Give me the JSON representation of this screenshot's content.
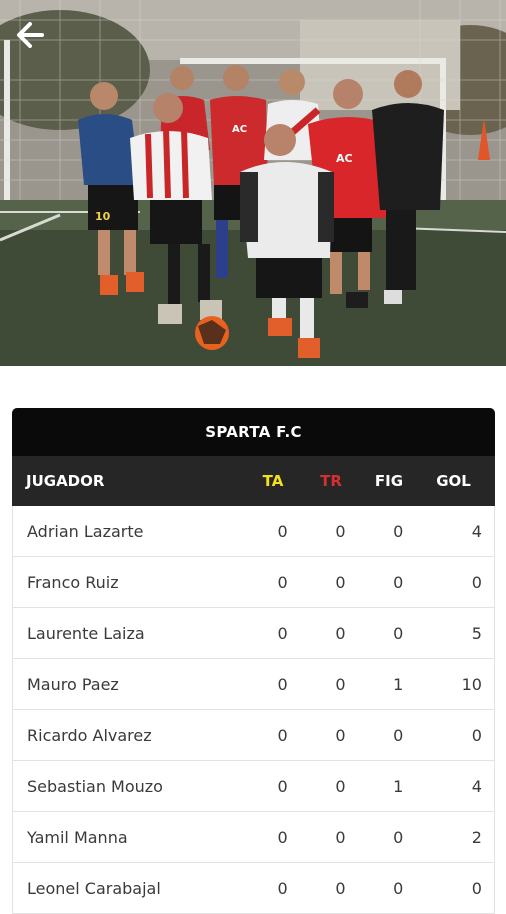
{
  "header": {
    "back_icon": "arrow-left-icon"
  },
  "photo": {
    "subject": "team-photo",
    "shirt_labels": [
      "10",
      "AC",
      "AC"
    ]
  },
  "table": {
    "team_name": "SPARTA F.C",
    "columns": {
      "player": "JUGADOR",
      "yellow": "TA",
      "red": "TR",
      "fig": "FIG",
      "goals": "GOL"
    },
    "colors": {
      "yellow_card": "#f2e21b",
      "red_card": "#d62f2f",
      "header_bg": "#0a0a0a",
      "subheader_bg": "#262626"
    },
    "rows": [
      {
        "name": "Adrian Lazarte",
        "ta": "0",
        "tr": "0",
        "fig": "0",
        "gol": "4"
      },
      {
        "name": "Franco Ruiz",
        "ta": "0",
        "tr": "0",
        "fig": "0",
        "gol": "0"
      },
      {
        "name": "Laurente Laiza",
        "ta": "0",
        "tr": "0",
        "fig": "0",
        "gol": "5"
      },
      {
        "name": "Mauro Paez",
        "ta": "0",
        "tr": "0",
        "fig": "1",
        "gol": "10"
      },
      {
        "name": "Ricardo Alvarez",
        "ta": "0",
        "tr": "0",
        "fig": "0",
        "gol": "0"
      },
      {
        "name": "Sebastian Mouzo",
        "ta": "0",
        "tr": "0",
        "fig": "1",
        "gol": "4"
      },
      {
        "name": "Yamil Manna",
        "ta": "0",
        "tr": "0",
        "fig": "0",
        "gol": "2"
      },
      {
        "name": "Leonel Carabajal",
        "ta": "0",
        "tr": "0",
        "fig": "0",
        "gol": "0"
      }
    ]
  }
}
